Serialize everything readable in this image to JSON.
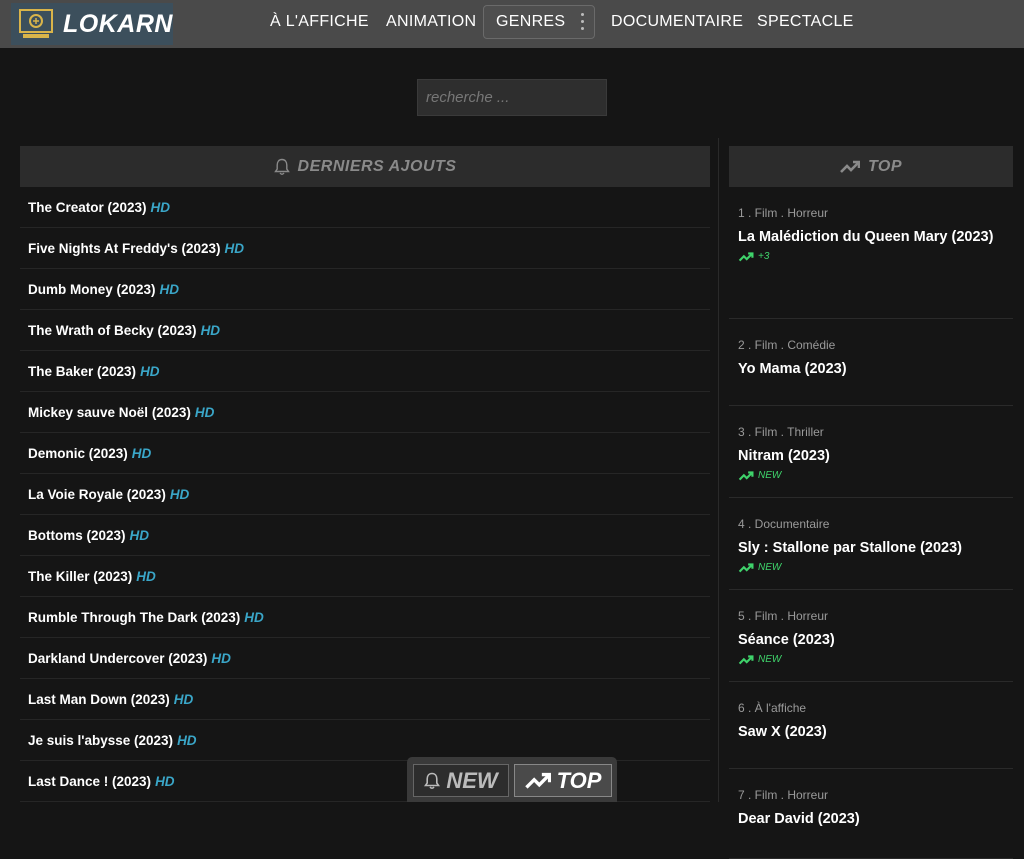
{
  "brand": {
    "name": "LOKARN",
    "logo_icon": "cinema-ticket-icon",
    "accent": "#3c4f5c"
  },
  "nav": {
    "items": [
      "À L'AFFICHE",
      "ANIMATION",
      "GENRES",
      "DOCUMENTAIRE",
      "SPECTACLE"
    ]
  },
  "search": {
    "placeholder": "recherche ...",
    "value": ""
  },
  "latest": {
    "title": "DERNIERS AJOUTS",
    "icon": "bell-icon",
    "badge": "HD",
    "badge_color": "#3aa6c8",
    "items": [
      "The Creator (2023)",
      "Five Nights At Freddy's (2023)",
      "Dumb Money (2023)",
      "The Wrath of Becky (2023)",
      "The Baker (2023)",
      "Mickey sauve Noël (2023)",
      "Demonic (2023)",
      "La Voie Royale (2023)",
      "Bottoms (2023)",
      "The Killer (2023)",
      "Rumble Through The Dark (2023)",
      "Darkland Undercover (2023)",
      "Last Man Down (2023)",
      "Je suis l'abysse (2023)",
      "Last Dance ! (2023)"
    ]
  },
  "top": {
    "title": "TOP",
    "icon": "trending-up-icon",
    "trend_color": "#3fd36b",
    "items": [
      {
        "meta": "1 . Film . Horreur",
        "title": "La Malédiction du Queen Mary (2023)",
        "trend": "+3"
      },
      {
        "meta": "2 . Film . Comédie",
        "title": "Yo Mama (2023)",
        "trend": ""
      },
      {
        "meta": "3 . Film . Thriller",
        "title": "Nitram (2023)",
        "trend": "NEW"
      },
      {
        "meta": "4 . Documentaire",
        "title": "Sly : Stallone par Stallone (2023)",
        "trend": "NEW"
      },
      {
        "meta": "5 . Film . Horreur",
        "title": "Séance (2023)",
        "trend": "NEW"
      },
      {
        "meta": "6 . À l'affiche",
        "title": "Saw X (2023)",
        "trend": ""
      },
      {
        "meta": "7 . Film . Horreur",
        "title": "Dear David (2023)",
        "trend": ""
      }
    ]
  },
  "floating": {
    "new_label": "NEW",
    "top_label": "TOP"
  }
}
